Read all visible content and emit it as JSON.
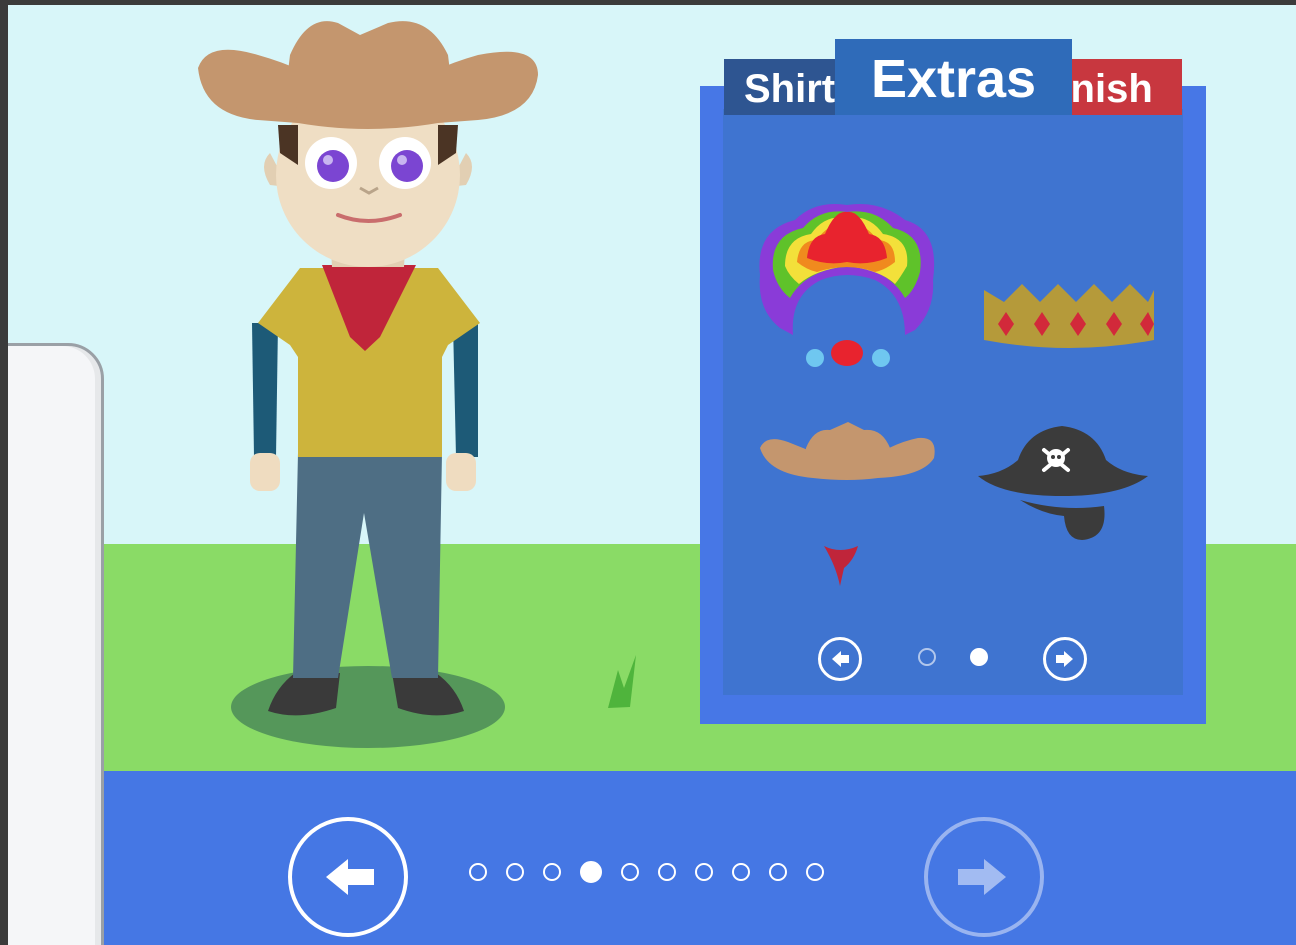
{
  "tabs": {
    "shirt_label": "Shirt",
    "extras_label": "Extras",
    "finish_label": "Finish",
    "active": "Extras"
  },
  "extras_panel": {
    "items": [
      {
        "name": "clown-wig-nose"
      },
      {
        "name": "gold-crown"
      },
      {
        "name": "cowboy-hat"
      },
      {
        "name": "pirate-hat-eyepatch"
      },
      {
        "name": "red-bandana"
      }
    ],
    "page_current": 2,
    "page_total": 2
  },
  "footer_nav": {
    "steps_total": 10,
    "step_current": 4
  },
  "colors": {
    "sky": "#d8f6f9",
    "grass": "#8adb66",
    "bar": "#4577e4",
    "panel_frame": "#4777e6",
    "panel_inner": "#3f74d0",
    "tab_shirt": "#2e5591",
    "tab_extras": "#2f6bb9",
    "tab_finish": "#c8373f"
  },
  "character": {
    "hat": "cowboy-hat",
    "eye_color": "#7b45d2",
    "shirt_color": "#cdb43c",
    "sleeve_color": "#1d5a77",
    "pants_color": "#4e6e84"
  }
}
